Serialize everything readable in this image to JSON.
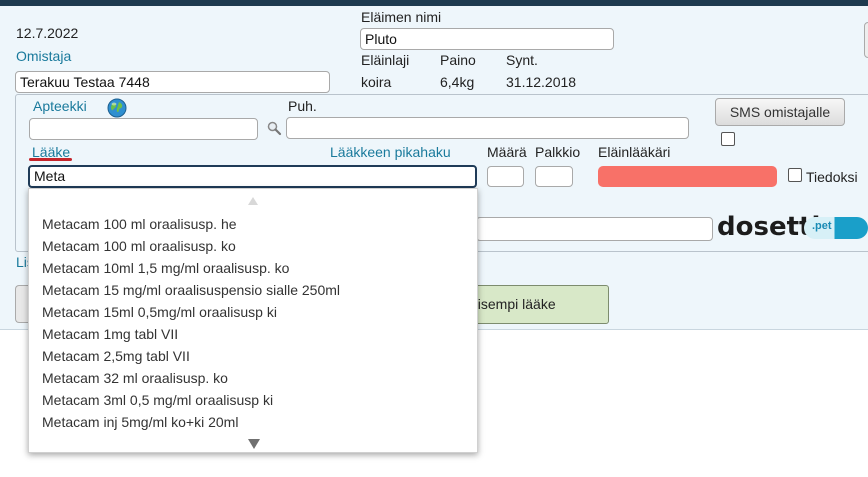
{
  "header": {
    "date": "12.7.2022",
    "owner_label": "Omistaja",
    "owner_value": "Terakuu Testaa 7448",
    "animal_name_label": "Eläimen nimi",
    "animal_name_value": "Pluto",
    "species_label": "Eläinlaji",
    "species_value": "koira",
    "weight_label": "Paino",
    "weight_value": "6,4kg",
    "birth_label": "Synt.",
    "birth_value": "31.12.2018"
  },
  "pharmacy": {
    "label": "Apteekki",
    "value": "",
    "globe_icon": "globe-icon",
    "search_icon": "magnifier-icon"
  },
  "phone": {
    "label": "Puh.",
    "value": ""
  },
  "sms_button_label": "SMS omistajalle",
  "medicine": {
    "label": "Lääke",
    "value": "Meta",
    "quicksearch_label": "Lääkkeen pikahaku",
    "amount_label": "Määrä",
    "fee_label": "Palkkio",
    "vet_label": "Eläinlääkäri",
    "vet_color": "#f87168",
    "inform_label": "Tiedoksi"
  },
  "dropdown": {
    "items": [
      "Metacam 100 ml oraalisusp. he",
      "Metacam 100 ml oraalisusp. ko",
      "Metacam 10ml 1,5 mg/ml oraalisusp. ko",
      "Metacam 15 mg/ml oraalisuspensio sialle 250ml",
      "Metacam 15ml 0,5mg/ml oraalisusp ki",
      "Metacam 1mg tabl VII",
      "Metacam 2,5mg tabl VII",
      "Metacam 32 ml oraalisusp. ko",
      "Metacam 3ml 0,5 mg/ml oraalisusp ki",
      "Metacam inj 5mg/ml ko+ki 20ml"
    ]
  },
  "partial_texts": {
    "lis": "Lis",
    "previous_med_button": "kaisempi lääke"
  },
  "logo": {
    "main": "dosetti",
    "suffix": ".pet"
  }
}
